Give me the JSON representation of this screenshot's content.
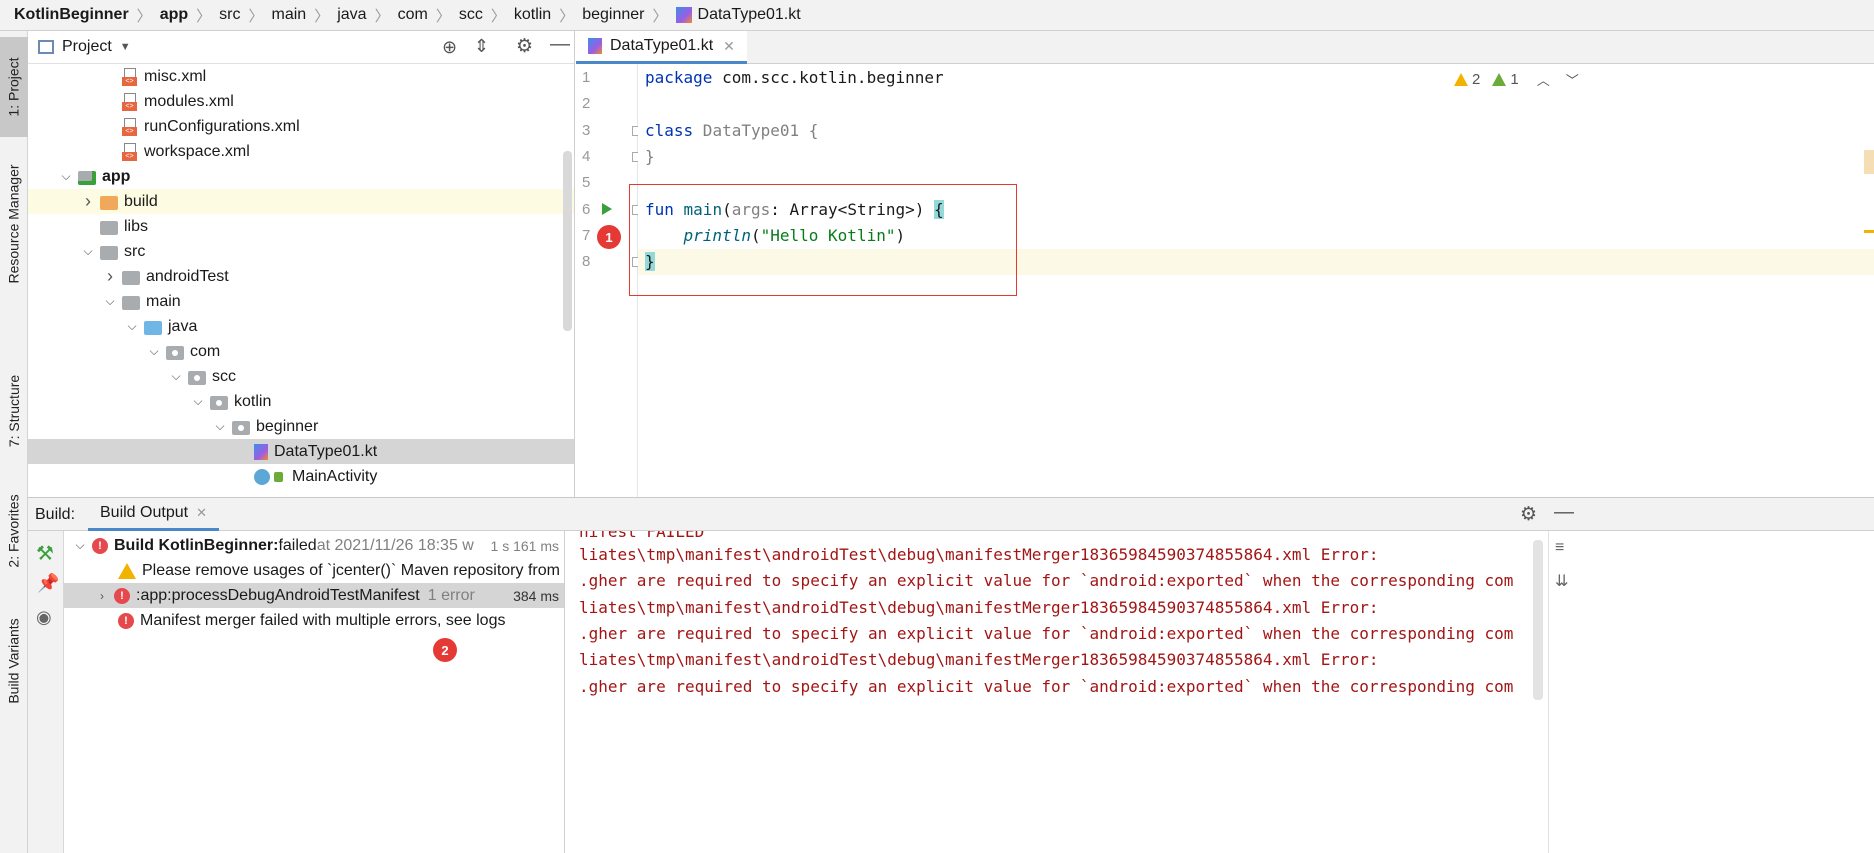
{
  "breadcrumb": [
    "KotlinBeginner",
    "app",
    "src",
    "main",
    "java",
    "com",
    "scc",
    "kotlin",
    "beginner",
    "DataType01.kt"
  ],
  "left_stripe": {
    "project": "1: Project",
    "resource_manager": "Resource Manager",
    "structure": "7: Structure",
    "favorites": "2: Favorites",
    "build_variants": "Build Variants"
  },
  "project_panel": {
    "title": "Project",
    "tree": [
      {
        "label": "misc.xml",
        "icon": "xml-file-icon",
        "expand": ""
      },
      {
        "label": "modules.xml",
        "icon": "xml-file-icon",
        "expand": ""
      },
      {
        "label": "runConfigurations.xml",
        "icon": "xml-file-icon",
        "expand": ""
      },
      {
        "label": "workspace.xml",
        "icon": "xml-file-icon",
        "expand": ""
      },
      {
        "label": "app",
        "icon": "module-folder-icon",
        "expand": "open"
      },
      {
        "label": "build",
        "icon": "folder-icon",
        "expand": "closed"
      },
      {
        "label": "libs",
        "icon": "folder-icon",
        "expand": ""
      },
      {
        "label": "src",
        "icon": "folder-icon",
        "expand": "open"
      },
      {
        "label": "androidTest",
        "icon": "folder-icon",
        "expand": "closed"
      },
      {
        "label": "main",
        "icon": "folder-icon",
        "expand": "open"
      },
      {
        "label": "java",
        "icon": "source-folder-icon",
        "expand": "open"
      },
      {
        "label": "com",
        "icon": "package-icon",
        "expand": "open"
      },
      {
        "label": "scc",
        "icon": "package-icon",
        "expand": "open"
      },
      {
        "label": "kotlin",
        "icon": "package-icon",
        "expand": "open"
      },
      {
        "label": "beginner",
        "icon": "package-icon",
        "expand": "open"
      },
      {
        "label": "DataType01.kt",
        "icon": "kotlin-file-icon",
        "expand": ""
      },
      {
        "label": "MainActivity",
        "icon": "activity-class-icon",
        "expand": ""
      }
    ]
  },
  "editor": {
    "tab_label": "DataType01.kt",
    "warnings": "2",
    "weak_warnings": "1",
    "line_numbers": [
      "1",
      "2",
      "3",
      "4",
      "5",
      "6",
      "7",
      "8"
    ],
    "code": {
      "l1_kw": "package",
      "l1_rest": " com.scc.kotlin.beginner",
      "l3_kw": "class",
      "l3_cls": " DataType01 ",
      "l3_brace": "{",
      "l4_brace": "}",
      "l6_kw": "fun",
      "l6_fn": " main",
      "l6_paren": "(",
      "l6_param": "args",
      "l6_type": ": Array<String>) ",
      "l6_brace": "{",
      "l7_indent": "    ",
      "l7_fn": "println",
      "l7_open": "(",
      "l7_str": "\"Hello Kotlin\"",
      "l7_close": ")",
      "l8_brace": "}"
    },
    "annotation_1": "1"
  },
  "build": {
    "label": "Build:",
    "tab": "Build Output",
    "tree": {
      "root_title": "Build KotlinBeginner:",
      "root_status": " failed",
      "root_time": " at 2021/11/26 18:35 w",
      "root_duration": "1 s 161 ms",
      "warning": "Please remove usages of `jcenter()` Maven repository from y",
      "task": ":app:processDebugAndroidTestManifest",
      "task_errors": "1 error",
      "task_duration": "384 ms",
      "error": "Manifest merger failed with multiple errors, see logs"
    },
    "annotation_2": "2",
    "console": [
      "nifest FAILED",
      "liates\\tmp\\manifest\\androidTest\\debug\\manifestMerger1836598459037485586​4.xml Error:",
      ".gher are required to specify an explicit value for `android:exported` when the corresponding com",
      "liates\\tmp\\manifest\\androidTest\\debug\\manifestMerger1836598459037485586​4.xml Error:",
      ".gher are required to specify an explicit value for `android:exported` when the corresponding com",
      "liates\\tmp\\manifest\\androidTest\\debug\\manifestMerger1836598459037485586​4.xml Error:",
      ".gher are required to specify an explicit value for `android:exported` when the corresponding com"
    ]
  },
  "colors": {
    "keyword": "#0033b3",
    "string": "#067d17",
    "error_red": "#e53935",
    "console_red": "#a31515",
    "selection_grey": "#d5d5d5"
  }
}
